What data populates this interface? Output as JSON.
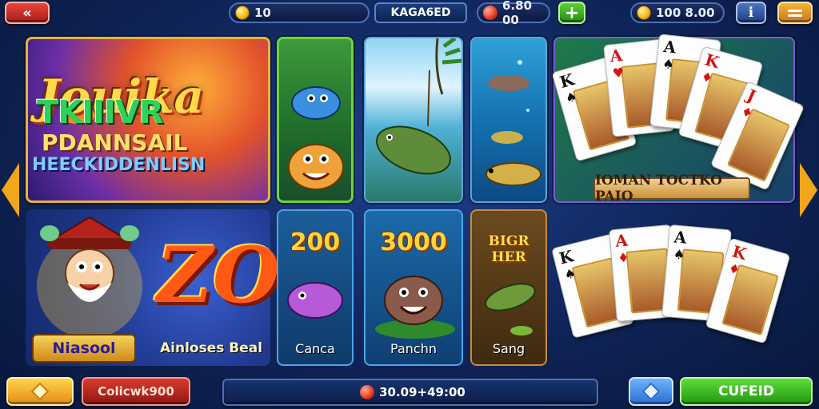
{
  "top": {
    "coins_value": "10",
    "label": "KAGA6ED",
    "rubies_value": "6.80 00",
    "gold_value": "100 8.00",
    "plus": "+",
    "info": "i",
    "back": "«"
  },
  "hero": {
    "title": "Jouika",
    "line1": "TKIIIVR",
    "line2": "PDANNSAIL",
    "line3": "HEECKIDDENLISN"
  },
  "cards_top": {
    "label": "IOMAN TOCTKO PAIO"
  },
  "wizard": {
    "big": "ZO",
    "badge": "Niasool",
    "caption": "Ainloses Beal"
  },
  "mini": [
    {
      "amount": "200",
      "label": "Canca"
    },
    {
      "amount": "3000",
      "label": "Panchn"
    },
    {
      "amount": "BIGR HER",
      "label": "Sang"
    }
  ],
  "cards_top_faces": [
    {
      "rank": "K",
      "suit": "♠",
      "color": "blk"
    },
    {
      "rank": "A",
      "suit": "♥",
      "color": "red"
    },
    {
      "rank": "A",
      "suit": "♠",
      "color": "blk"
    },
    {
      "rank": "K",
      "suit": "♦",
      "color": "red"
    },
    {
      "rank": "J",
      "suit": "♦",
      "color": "red"
    }
  ],
  "cards_bottom_faces": [
    {
      "rank": "K",
      "suit": "♠",
      "color": "blk"
    },
    {
      "rank": "A",
      "suit": "♦",
      "color": "red"
    },
    {
      "rank": "A",
      "suit": "♠",
      "color": "blk"
    },
    {
      "rank": "K",
      "suit": "♦",
      "color": "red"
    }
  ],
  "bottom": {
    "red_label": "Colicwk900",
    "mid_value": "30.09+49:00",
    "green_label": "CUFEID"
  }
}
